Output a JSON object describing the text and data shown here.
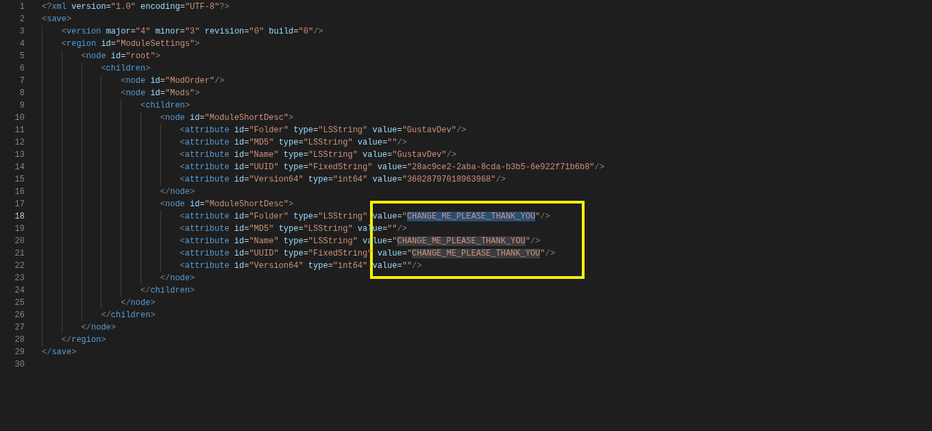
{
  "editor": {
    "lines": [
      {
        "number": "1",
        "current": false,
        "segments": [
          {
            "text": "<?xml version=\"1.0\" encoding=\"UTF-8\"?>"
          }
        ]
      },
      {
        "number": "2",
        "current": false,
        "segments": [
          {
            "text": "<save>"
          }
        ]
      },
      {
        "number": "3",
        "current": false,
        "segments": [
          {
            "text": "    <version major=\"4\" minor=\"3\" revision=\"0\" build=\"0\"/>"
          }
        ]
      },
      {
        "number": "4",
        "current": false,
        "segments": [
          {
            "text": "    <region id=\"ModuleSettings\">"
          }
        ]
      },
      {
        "number": "5",
        "current": false,
        "segments": [
          {
            "text": "        <node id=\"root\">"
          }
        ]
      },
      {
        "number": "6",
        "current": false,
        "segments": [
          {
            "text": "            <children>"
          }
        ]
      },
      {
        "number": "7",
        "current": false,
        "segments": [
          {
            "text": "                <node id=\"ModOrder\"/>"
          }
        ]
      },
      {
        "number": "8",
        "current": false,
        "segments": [
          {
            "text": "                <node id=\"Mods\">"
          }
        ]
      },
      {
        "number": "9",
        "current": false,
        "segments": [
          {
            "text": "                    <children>"
          }
        ]
      },
      {
        "number": "10",
        "current": false,
        "segments": [
          {
            "text": "                        <node id=\"ModuleShortDesc\">"
          }
        ]
      },
      {
        "number": "11",
        "current": false,
        "segments": [
          {
            "text": "                            <attribute id=\"Folder\" type=\"LSString\" value=\"GustavDev\"/>"
          }
        ]
      },
      {
        "number": "12",
        "current": false,
        "segments": [
          {
            "text": "                            <attribute id=\"MD5\" type=\"LSString\" value=\"\"/>"
          }
        ]
      },
      {
        "number": "13",
        "current": false,
        "segments": [
          {
            "text": "                            <attribute id=\"Name\" type=\"LSString\" value=\"GustavDev\"/>"
          }
        ]
      },
      {
        "number": "14",
        "current": false,
        "segments": [
          {
            "text": "                            <attribute id=\"UUID\" type=\"FixedString\" value=\"28ac9ce2-2aba-8cda-b3b5-6e922f71b6b8\"/>"
          }
        ]
      },
      {
        "number": "15",
        "current": false,
        "segments": [
          {
            "text": "                            <attribute id=\"Version64\" type=\"int64\" value=\"36028797018963968\"/>"
          }
        ]
      },
      {
        "number": "16",
        "current": false,
        "segments": [
          {
            "text": "                        </node>"
          }
        ]
      },
      {
        "number": "17",
        "current": false,
        "segments": [
          {
            "text": "                        <node id=\"ModuleShortDesc\">"
          }
        ]
      },
      {
        "number": "18",
        "current": true,
        "segments": [
          {
            "text": "                            <attribute id=\"Folder\" type=\"LSString\" value=\""
          },
          {
            "text": "CHANGE_ME_PLEASE_THANK_YOU",
            "match": true,
            "selected": true
          },
          {
            "text": "\"/>"
          }
        ]
      },
      {
        "number": "19",
        "current": false,
        "segments": [
          {
            "text": "                            <attribute id=\"MD5\" type=\"LSString\" value=\"\"/>"
          }
        ]
      },
      {
        "number": "20",
        "current": false,
        "segments": [
          {
            "text": "                            <attribute id=\"Name\" type=\"LSString\" value=\""
          },
          {
            "text": "CHANGE_ME_PLEASE_THANK_YOU",
            "match": true,
            "selected": false
          },
          {
            "text": "\"/>"
          }
        ]
      },
      {
        "number": "21",
        "current": false,
        "segments": [
          {
            "text": "                            <attribute id=\"UUID\" type=\"FixedString\" value=\""
          },
          {
            "text": "CHANGE_ME_PLEASE_THANK_YOU",
            "match": true,
            "selected": false
          },
          {
            "text": "\"/>"
          }
        ]
      },
      {
        "number": "22",
        "current": false,
        "segments": [
          {
            "text": "                            <attribute id=\"Version64\" type=\"int64\" value=\"\"/>"
          }
        ]
      },
      {
        "number": "23",
        "current": false,
        "segments": [
          {
            "text": "                        </node>"
          }
        ]
      },
      {
        "number": "24",
        "current": false,
        "segments": [
          {
            "text": "                    </children>"
          }
        ]
      },
      {
        "number": "25",
        "current": false,
        "segments": [
          {
            "text": "                </node>"
          }
        ]
      },
      {
        "number": "26",
        "current": false,
        "segments": [
          {
            "text": "            </children>"
          }
        ]
      },
      {
        "number": "27",
        "current": false,
        "segments": [
          {
            "text": "        </node>"
          }
        ]
      },
      {
        "number": "28",
        "current": false,
        "segments": [
          {
            "text": "    </region>"
          }
        ]
      },
      {
        "number": "29",
        "current": false,
        "segments": [
          {
            "text": "</save>"
          }
        ]
      },
      {
        "number": "30",
        "current": false
      }
    ]
  }
}
